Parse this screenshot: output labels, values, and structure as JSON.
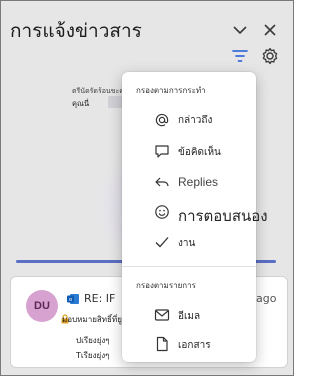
{
  "pane": {
    "title": "การแจ้งข่าวสาร",
    "icons": {
      "collapse": "chevron-down-icon",
      "close": "close-icon",
      "filter": "filter-icon",
      "settings": "gear-icon"
    },
    "colors": {
      "accent": "#5b6fc4",
      "filter_icon": "#3b6bd8"
    }
  },
  "empty_state": {
    "line1": "ตรีนัดรัดร้อนขะคุณ",
    "line2": "คุณนี่"
  },
  "notification_card": {
    "avatar_initials": "DU",
    "avatar_color": "#d8a2d0",
    "subject_prefix": "RE: IF",
    "time": "ago",
    "line1": "มอบหมายสิทธิ์ที่ยูดกับว่",
    "line2": "ปเรียงยุ่งๆ",
    "line3": "Tเรียงยุ่งๆ"
  },
  "filter_menu": {
    "section1_heading": "กรองตามการกระทำ",
    "section2_heading": "กรองตามรายการ",
    "items": [
      {
        "icon": "at-icon",
        "label": "กล่าวถึง"
      },
      {
        "icon": "comment-icon",
        "label": "ข้อคิดเห็น"
      },
      {
        "icon": "reply-icon",
        "label": "Replies"
      },
      {
        "icon": "smiley-icon",
        "label": "การตอบสนอง"
      },
      {
        "icon": "checkmark-icon",
        "label": "งาน"
      },
      {
        "icon": "mail-icon",
        "label": "อีเมล"
      },
      {
        "icon": "document-icon",
        "label": "เอกสาร"
      }
    ]
  }
}
